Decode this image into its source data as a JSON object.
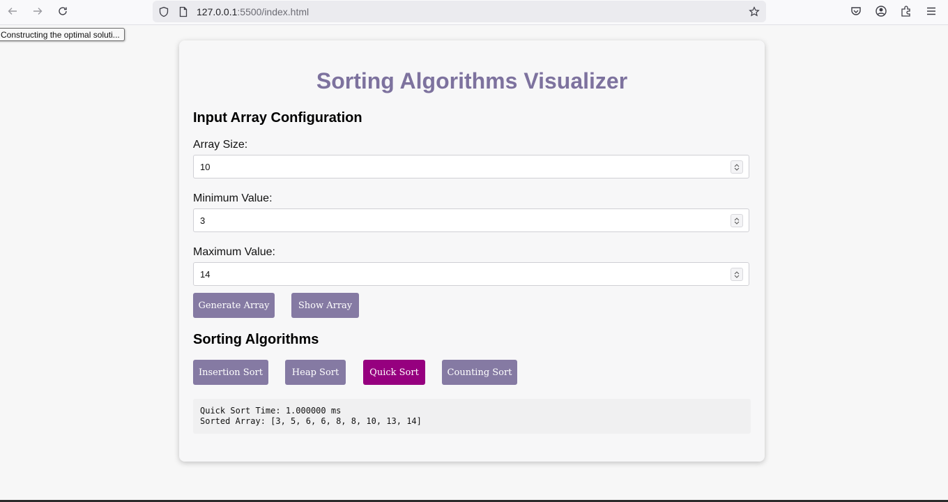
{
  "browser": {
    "url_host": "127.0.0.1",
    "url_rest": ":5500/index.html",
    "tooltip": "Constructing the optimal soluti..."
  },
  "page": {
    "title": "Sorting Algorithms Visualizer",
    "config_heading": "Input Array Configuration",
    "array_size_label": "Array Size:",
    "array_size_value": "10",
    "min_label": "Minimum Value:",
    "min_value": "3",
    "max_label": "Maximum Value:",
    "max_value": "14",
    "generate_button": "Generate Array",
    "show_button": "Show Array",
    "algorithms_heading": "Sorting Algorithms",
    "algorithms": [
      {
        "label": "Insertion Sort"
      },
      {
        "label": "Heap Sort"
      },
      {
        "label": "Quick Sort",
        "active": true
      },
      {
        "label": "Counting Sort"
      }
    ],
    "output_line1": "Quick Sort Time: 1.000000 ms",
    "output_line2": "Sorted Array: [3, 5, 6, 6, 8, 8, 10, 13, 14]"
  },
  "colors": {
    "accent": "#857aa3",
    "active": "#96007f",
    "title": "#7d729e"
  },
  "icons": [
    "back-icon",
    "forward-icon",
    "reload-icon",
    "shield-icon",
    "page-icon",
    "bookmark-star-icon",
    "pocket-icon",
    "account-icon",
    "extensions-icon",
    "menu-icon"
  ]
}
